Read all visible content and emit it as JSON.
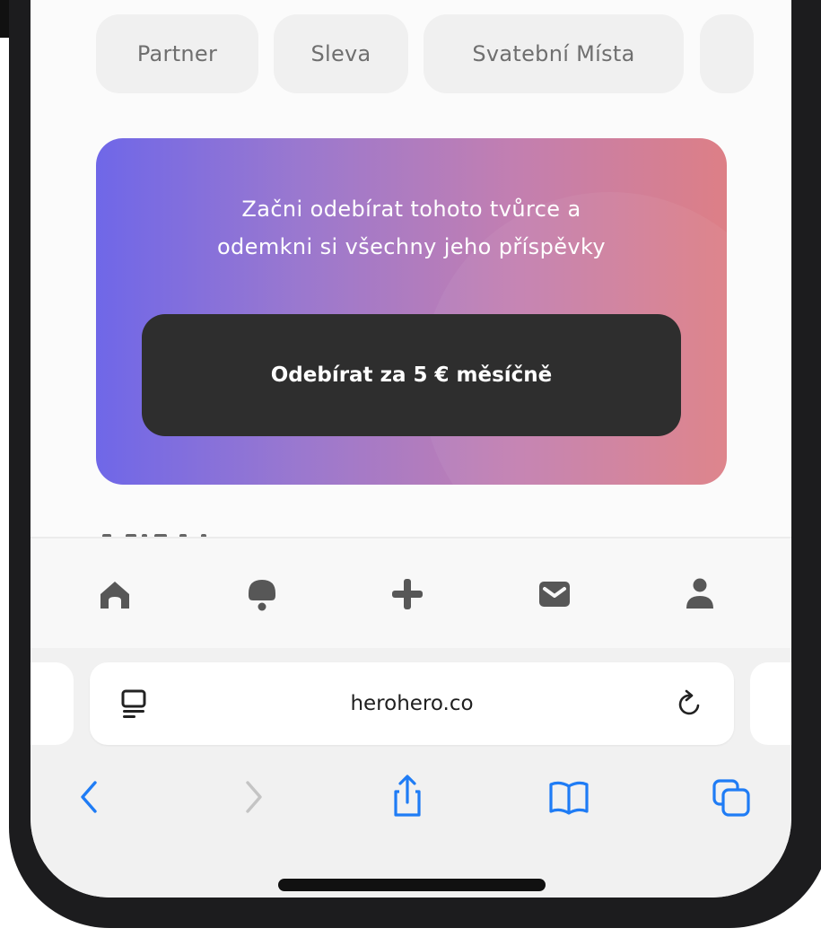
{
  "filters": {
    "chips": [
      {
        "label": "Partner"
      },
      {
        "label": "Sleva"
      },
      {
        "label": "Svatební Místa"
      },
      {
        "label": ""
      }
    ]
  },
  "promo": {
    "line1": "Začni odebírat tohoto tvůrce a",
    "line2": "odemkni si všechny jeho příspěvky",
    "button_label": "Odebírat za 5 € měsíčně",
    "gradient_start": "#6f67e8",
    "gradient_end": "#dd7f86"
  },
  "bottom_nav": {
    "icons": [
      "home-icon",
      "notifications-icon",
      "add-post-icon",
      "messages-icon",
      "profile-icon"
    ],
    "icon_color": "#575757"
  },
  "browser": {
    "url": "herohero.co",
    "page_menu_icon": "page-menu-icon",
    "reload_icon": "reload-icon",
    "toolbar_icons": [
      "back-icon",
      "forward-icon",
      "share-icon",
      "bookmarks-icon",
      "tabs-icon"
    ],
    "accent_color": "#1f7cf5"
  }
}
